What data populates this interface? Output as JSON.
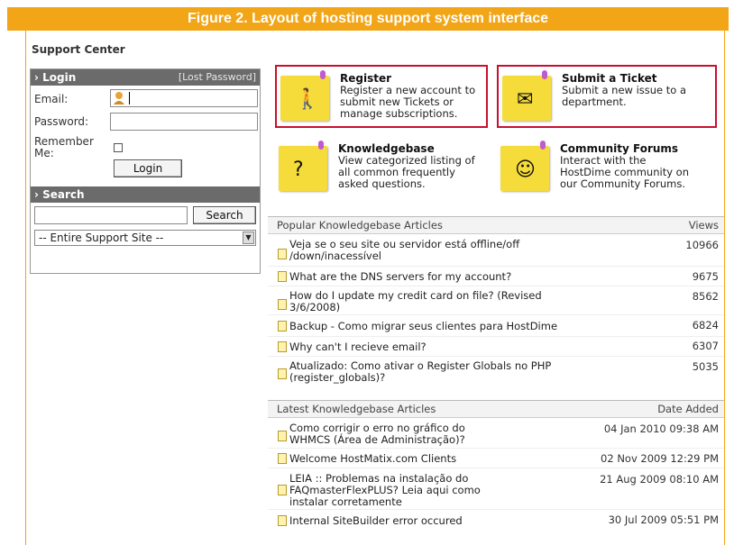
{
  "figure_title": "Figure 2. Layout of hosting support system interface",
  "page_title": "Support Center",
  "login": {
    "header": "› Login",
    "lost_password": "[Lost Password]",
    "email_label": "Email:",
    "email_value": "",
    "password_label": "Password:",
    "remember_label_1": "Remember",
    "remember_label_2": "Me:",
    "login_button": "Login"
  },
  "search": {
    "header": "› Search",
    "button": "Search",
    "scope_selected": "-- Entire Support Site --"
  },
  "tiles": [
    {
      "title": "Register",
      "lines": [
        "Register a new account to",
        "submit new Tickets or",
        "manage subscriptions."
      ],
      "icon": "walking-figure-icon"
    },
    {
      "title": "Submit a Ticket",
      "lines": [
        "Submit a new issue to a",
        "department."
      ],
      "icon": "envelope-icon"
    },
    {
      "title": "Knowledgebase",
      "lines": [
        "View categorized listing of",
        "all common frequently",
        "asked questions."
      ],
      "icon": "question-mark-icon"
    },
    {
      "title": "Community Forums",
      "lines": [
        "Interact with the",
        "HostDime community on",
        "our Community Forums."
      ],
      "icon": "chat-icon"
    }
  ],
  "popular": {
    "header": "Popular Knowledgebase Articles",
    "col": "Views",
    "rows": [
      {
        "lines": [
          "Veja se o seu site ou servidor está offline/off",
          "/down/inacessível"
        ],
        "value": "10966"
      },
      {
        "lines": [
          "What are the DNS servers for my account?"
        ],
        "value": "9675"
      },
      {
        "lines": [
          "How do I update my credit card on file? (Revised",
          "3/6/2008)"
        ],
        "value": "8562"
      },
      {
        "lines": [
          "Backup - Como migrar seus clientes para HostDime"
        ],
        "value": "6824"
      },
      {
        "lines": [
          "Why can't I recieve email?"
        ],
        "value": "6307"
      },
      {
        "lines": [
          "Atualizado: Como ativar o Register Globals no PHP",
          "(register_globals)?"
        ],
        "value": "5035"
      }
    ]
  },
  "latest": {
    "header": "Latest Knowledgebase Articles",
    "col": "Date Added",
    "rows": [
      {
        "lines": [
          "Como corrigir o erro no gráfico do",
          "WHMCS (Área de Administração)?"
        ],
        "value": "04 Jan 2010 09:38 AM"
      },
      {
        "lines": [
          "Welcome HostMatix.com Clients"
        ],
        "value": "02 Nov 2009 12:29 PM"
      },
      {
        "lines": [
          "LEIA :: Problemas na instalação do",
          "FAQmasterFlexPLUS? Leia aqui como",
          "instalar corretamente"
        ],
        "value": "21 Aug 2009 08:10 AM"
      },
      {
        "lines": [
          "Internal SiteBuilder error occured"
        ],
        "value": "30 Jul 2009 05:51 PM"
      }
    ]
  }
}
